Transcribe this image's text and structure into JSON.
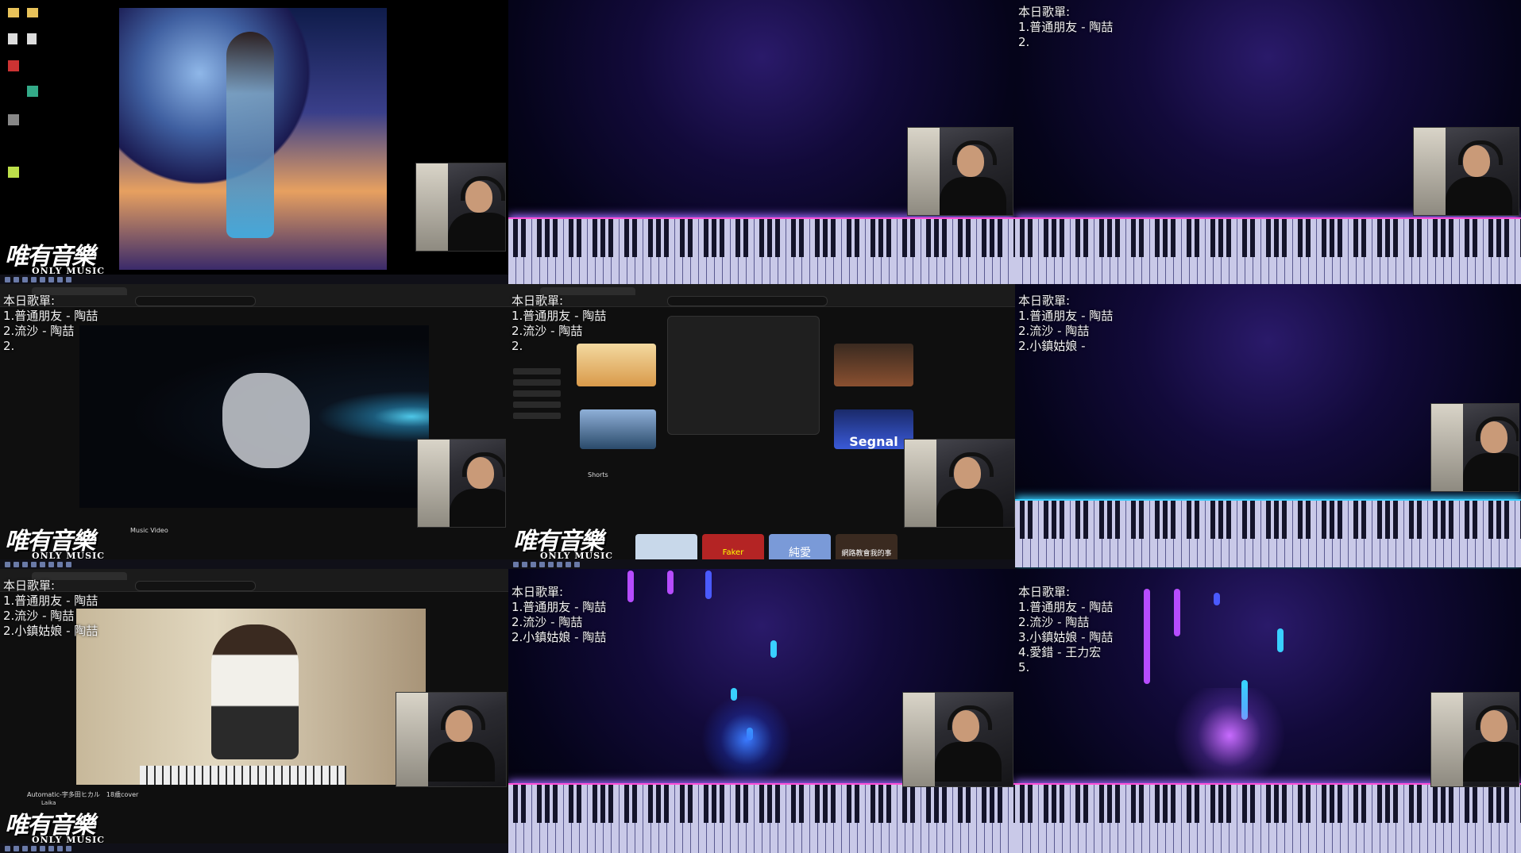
{
  "setlist": {
    "title": "本日歌單:",
    "v1": [
      "1.普通朋友 - 陶喆",
      "2."
    ],
    "v2": [
      "1.普通朋友 - 陶喆",
      "2.流沙 - 陶喆",
      "2."
    ],
    "v3": [
      "1.普通朋友 - 陶喆",
      "2.流沙 - 陶喆",
      "2."
    ],
    "v4": [
      "1.普通朋友 - 陶喆",
      "2.流沙 - 陶喆",
      "2.小鎮姑娘 -"
    ],
    "v5": [
      "1.普通朋友 - 陶喆",
      "2.流沙 - 陶喆",
      "2.小鎮姑娘 - 陶喆"
    ],
    "v6": [
      "1.普通朋友 - 陶喆",
      "2.流沙 - 陶喆",
      "2.小鎮姑娘 - 陶喆"
    ],
    "v7": [
      "1.普通朋友 - 陶喆",
      "2.流沙 - 陶喆",
      "3.小鎮姑娘 - 陶喆",
      "4.愛錯 - 王力宏",
      "5."
    ]
  },
  "logo": {
    "main": "唯有音樂",
    "sub": "ONLY MUSIC"
  },
  "youtube": {
    "tile4_title": "Music Video",
    "tile7_title": "Automatic-宇多田ヒカル　18歳cover",
    "channel": "Laika",
    "shorts": "Shorts",
    "thumb_segnal": "Segnal",
    "thumb_faker": "Faker",
    "thumb_love": "純愛",
    "thumb_news": "網路教會我的事"
  },
  "colors": {
    "accent_pink": "#ff4fd8",
    "accent_cyan": "#39d0ff",
    "bg_space": "#120a3a"
  }
}
